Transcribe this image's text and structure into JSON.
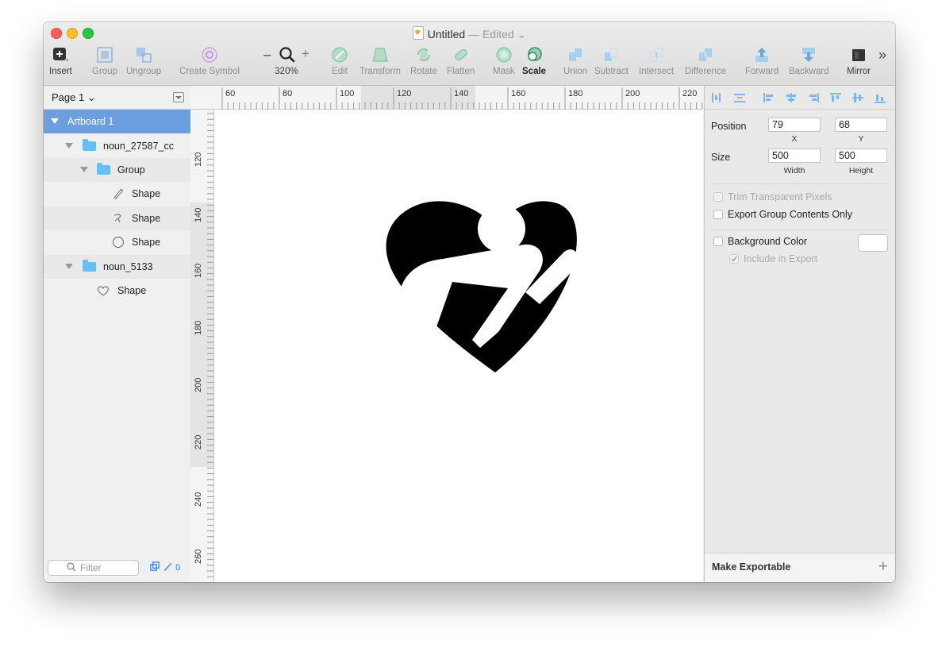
{
  "window": {
    "title": "Untitled",
    "title_sep": " — ",
    "title_status": "Edited",
    "title_chevron": "⌄"
  },
  "toolbar": {
    "insert": "Insert",
    "group": "Group",
    "ungroup": "Ungroup",
    "create_symbol": "Create Symbol",
    "zoom_minus": "–",
    "zoom_plus": "+",
    "zoom_level": "320%",
    "edit": "Edit",
    "transform": "Transform",
    "rotate": "Rotate",
    "flatten": "Flatten",
    "mask": "Mask",
    "scale": "Scale",
    "union": "Union",
    "subtract": "Subtract",
    "intersect": "Intersect",
    "difference": "Difference",
    "forward": "Forward",
    "backward": "Backward",
    "mirror": "Mirror",
    "overflow": "»"
  },
  "layers": {
    "page": "Page 1 ⌄",
    "items": [
      {
        "label": "Artboard 1"
      },
      {
        "label": "noun_27587_cc"
      },
      {
        "label": "Group"
      },
      {
        "label": "Shape"
      },
      {
        "label": "Shape"
      },
      {
        "label": "Shape"
      },
      {
        "label": "noun_5133"
      },
      {
        "label": "Shape"
      }
    ],
    "filter_placeholder": "Filter",
    "filter_count": "0"
  },
  "rulers": {
    "top": [
      "60",
      "80",
      "100",
      "120",
      "140",
      "160",
      "180",
      "200",
      "220"
    ],
    "left": [
      "120",
      "140",
      "160",
      "180",
      "200",
      "220",
      "240",
      "260"
    ]
  },
  "inspector": {
    "position_label": "Position",
    "x_value": "79",
    "y_value": "68",
    "x_label": "X",
    "y_label": "Y",
    "size_label": "Size",
    "width_value": "500",
    "height_value": "500",
    "width_label": "Width",
    "height_label": "Height",
    "trim_label": "Trim Transparent Pixels",
    "export_group_label": "Export Group Contents Only",
    "background_color_label": "Background Color",
    "include_export_label": "Include in Export",
    "make_exportable": "Make Exportable",
    "add_symbol": "+",
    "swatch_color": "#ffffff"
  },
  "colors": {
    "selection": "#6c9fdf",
    "folder": "#68bdf2",
    "accent_icon": "#57b59a"
  }
}
